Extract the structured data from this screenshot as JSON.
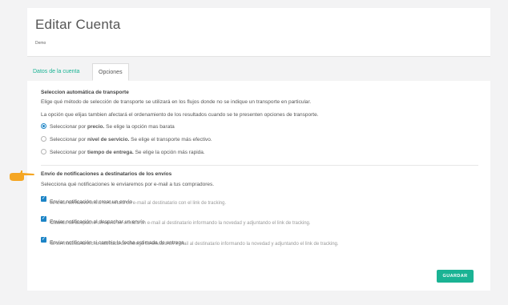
{
  "header": {
    "title": "Editar Cuenta",
    "subtitle": "Demo"
  },
  "tabs": [
    {
      "label": "Datos de la cuenta",
      "active": false
    },
    {
      "label": "Opciones",
      "active": true
    }
  ],
  "transport": {
    "title": "Seleccion automática de transporte",
    "description": "Elige qué método de selección de transporte se utilizará en los flujos donde no se indique un transporte en particular.",
    "ordering_note": "La opción que elijas tambien afectará el ordenamiento de los resultados cuando se te presenten opciones de transporte.",
    "options": [
      {
        "prefix": "Seleccionar por ",
        "strong": "precio.",
        "suffix": " Se elige la opción mas barata",
        "selected": true
      },
      {
        "prefix": "Seleccionar por ",
        "strong": "nivel de servicio.",
        "suffix": " Se elige el transporte más efectivo.",
        "selected": false
      },
      {
        "prefix": "Seleccionar por ",
        "strong": "tiempo de entrega.",
        "suffix": " Se elige la opción más rapida.",
        "selected": false
      }
    ]
  },
  "notifications": {
    "title": "Envío de notificaciones a destinatarios de los envíos",
    "description": "Selecciona qué notificaciones le enviaremos por e-mail a tus compradores.",
    "items": [
      {
        "label": "Enviar notificación al crear un envío",
        "description": "Al crear un nuevo envío se enviará un e-mail al destinatario con el link de tracking.",
        "checked": true
      },
      {
        "label": "Enviar notificación al despachar un envío",
        "description": "Cuando se despache un envío se enviará un e-mail al destinatario informando la novedad y adjuntando el link de tracking.",
        "checked": true
      },
      {
        "label": "Enviar notificación si cambia la fecha estimada de entrega",
        "description": "Si se modifica la fecha estimada de entrega se enviará un e-mail al destinatario informando la novedad y adjuntando el link de tracking.",
        "checked": true
      }
    ]
  },
  "save_label": "GUARDAR",
  "colors": {
    "accent": "#1ab394",
    "primary": "#1c84c6",
    "pointer": "#f5a623"
  },
  "pointer_icon": "pointing-hand-icon"
}
